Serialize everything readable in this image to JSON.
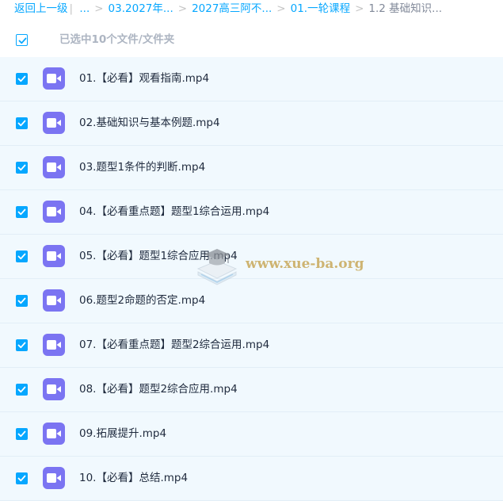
{
  "breadcrumb": {
    "back": "返回上一级",
    "items": [
      "...",
      "03.2027年...",
      "2027高三阿不...",
      "01.一轮课程"
    ],
    "current": "1.2 基础知识..."
  },
  "selection": {
    "label": "已选中10个文件/文件夹"
  },
  "files": [
    {
      "name": "01.【必看】观看指南.mp4",
      "checked": true
    },
    {
      "name": "02.基础知识与基本例题.mp4",
      "checked": true
    },
    {
      "name": "03.题型1条件的判断.mp4",
      "checked": true
    },
    {
      "name": "04.【必看重点题】题型1综合运用.mp4",
      "checked": true
    },
    {
      "name": "05.【必看】题型1综合应用.mp4",
      "checked": true
    },
    {
      "name": "06.题型2命题的否定.mp4",
      "checked": true
    },
    {
      "name": "07.【必看重点题】题型2综合运用.mp4",
      "checked": true
    },
    {
      "name": "08.【必看】题型2综合应用.mp4",
      "checked": true
    },
    {
      "name": "09.拓展提升.mp4",
      "checked": true
    },
    {
      "name": "10.【必看】总结.mp4",
      "checked": true
    }
  ],
  "file_icon": "video-file-icon",
  "watermark": "www.xue-ba.org",
  "colors": {
    "accent": "#06a7ff",
    "row_bg": "#f1f9fe",
    "video_icon": "#7b74f2",
    "watermark": "#c9a95a"
  }
}
